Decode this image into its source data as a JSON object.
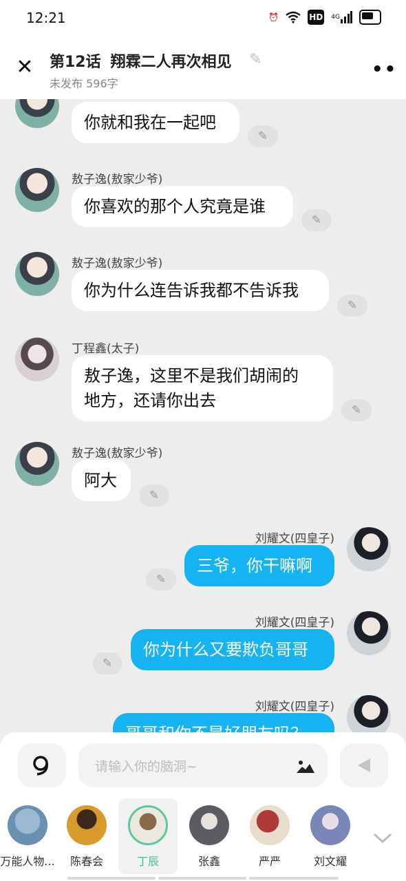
{
  "status": {
    "time": "12:21",
    "icons": [
      "alarm-icon",
      "wifi-icon",
      "hd-icon",
      "signal-4g-icon",
      "battery-icon"
    ],
    "hd": "HD",
    "net": "4G"
  },
  "header": {
    "episode": "第12话",
    "title": "翔霖二人再次相见",
    "subtitle": "未发布 596字"
  },
  "messages": [
    {
      "speaker": "",
      "text": "你就和我在一起吧",
      "side": "left"
    },
    {
      "speaker": "敖子逸(敖家少爷)",
      "text": "你喜欢的那个人究竟是谁",
      "side": "left"
    },
    {
      "speaker": "敖子逸(敖家少爷)",
      "text": "你为什么连告诉我都不告诉我",
      "side": "left"
    },
    {
      "speaker": "丁程鑫(太子)",
      "text_lines": [
        "敖子逸，这里不是我们胡闹的",
        "地方，还请你出去"
      ],
      "side": "left"
    },
    {
      "speaker": "敖子逸(敖家少爷)",
      "text": "阿大",
      "side": "left"
    },
    {
      "speaker": "刘耀文(四皇子)",
      "text": "三爷，你干嘛啊",
      "side": "right"
    },
    {
      "speaker": "刘耀文(四皇子)",
      "text": "你为什么又要欺负哥哥",
      "side": "right"
    },
    {
      "speaker": "刘耀文(四皇子)",
      "text": "哥哥和你不是好朋友吗？",
      "side": "right"
    }
  ],
  "input": {
    "placeholder": "请输入你的脑洞~"
  },
  "characters": [
    {
      "name": "万能人物...",
      "color": "#6b8fb0"
    },
    {
      "name": "陈春会",
      "color": "#d89a2a"
    },
    {
      "name": "丁辰",
      "color": "#8a6a4a",
      "selected": true
    },
    {
      "name": "张鑫",
      "color": "#5c5c62"
    },
    {
      "name": "严严",
      "color": "#b03a3a"
    },
    {
      "name": "刘文耀",
      "color": "#7a86b8"
    }
  ],
  "colors": {
    "accent": "#15b3f2",
    "selected": "#57c99a"
  }
}
